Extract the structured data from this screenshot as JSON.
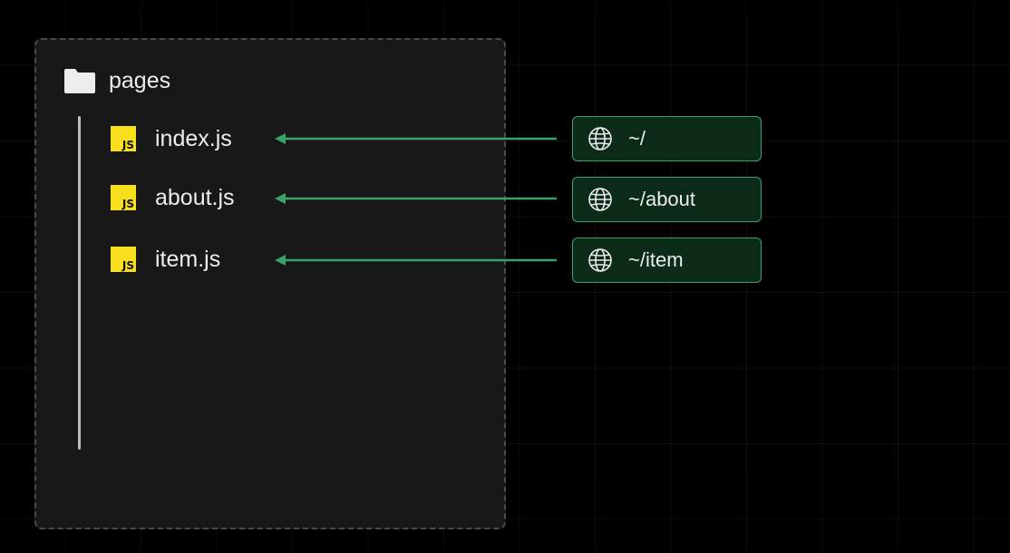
{
  "folder": {
    "icon": "folder-icon",
    "label": "pages"
  },
  "files": [
    {
      "label": "index.js",
      "icon": "js-file-icon",
      "badge": "JS"
    },
    {
      "label": "about.js",
      "icon": "js-file-icon",
      "badge": "JS"
    },
    {
      "label": "item.js",
      "icon": "js-file-icon",
      "badge": "JS"
    }
  ],
  "routes": [
    {
      "label": "~/",
      "icon": "globe-icon"
    },
    {
      "label": "~/about",
      "icon": "globe-icon"
    },
    {
      "label": "~/item",
      "icon": "globe-icon"
    }
  ],
  "colors": {
    "background": "#000000",
    "panel": "#1a1a1a",
    "panel_border": "#4a4a4a",
    "text": "#ededed",
    "js_badge": "#f7df1e",
    "arrow": "#3aa36a",
    "route_fill": "#0b2a18",
    "route_border": "#3aa36a"
  }
}
